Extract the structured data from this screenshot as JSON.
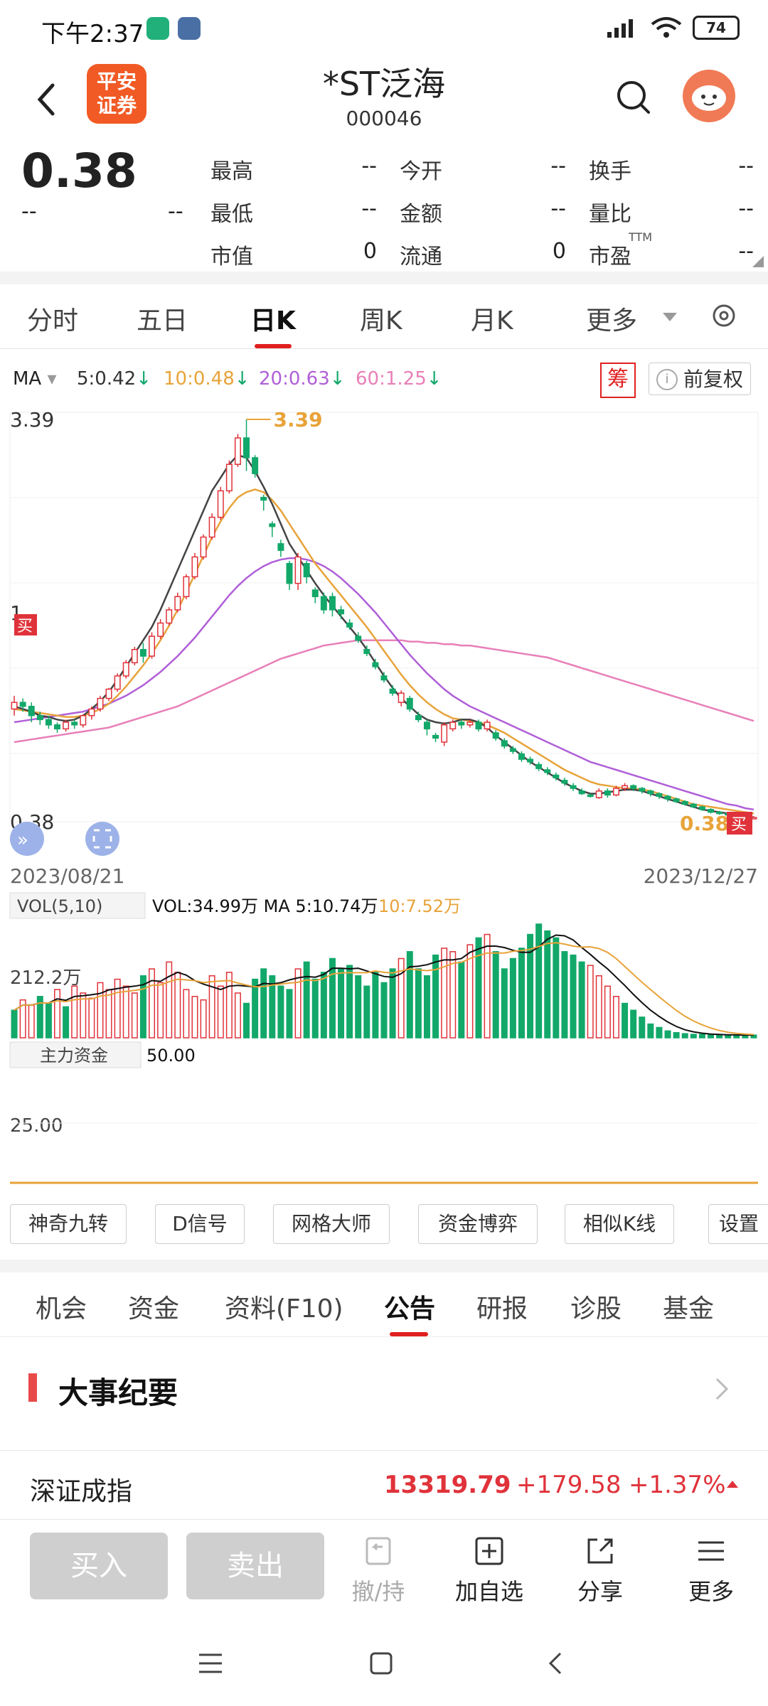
{
  "status_bar": {
    "time": "下午2:37",
    "battery": "74"
  },
  "header": {
    "logo_line1": "平安",
    "logo_line2": "证券",
    "title": "*ST泛海",
    "code": "000046"
  },
  "quote": {
    "price": "0.38",
    "change": "--",
    "change_pct": "--",
    "fields": [
      {
        "label": "最高",
        "value": "--"
      },
      {
        "label": "今开",
        "value": "--"
      },
      {
        "label": "换手",
        "value": "--"
      },
      {
        "label": "最低",
        "value": "--"
      },
      {
        "label": "金额",
        "value": "--"
      },
      {
        "label": "量比",
        "value": "--"
      },
      {
        "label": "市值",
        "value": "0"
      },
      {
        "label": "流通",
        "value": "0"
      },
      {
        "label": "市盈",
        "value": "--"
      }
    ],
    "pe_superscript": "TTM"
  },
  "kline_tabs": [
    "分时",
    "五日",
    "日K",
    "周K",
    "月K",
    "更多"
  ],
  "kline_active": "日K",
  "ma_bar": {
    "label": "MA",
    "items": [
      {
        "text": "5:0.42",
        "color": "#333333"
      },
      {
        "text": "10:0.48",
        "color": "#e8a33a"
      },
      {
        "text": "20:0.63",
        "color": "#b05fd8"
      },
      {
        "text": "60:1.25",
        "color": "#e87fb8"
      }
    ],
    "chip_label": "筹",
    "adjust_label": "前复权"
  },
  "chart_data": {
    "type": "candlestick",
    "price_high_label": "3.39",
    "price_low_label": "0.38",
    "price_mid_label": "1",
    "max_marker": "3.39",
    "last_marker": "0.38",
    "buy_marker": "买",
    "date_start": "2023/08/21",
    "date_end": "2023/12/27",
    "ylim": [
      0.38,
      3.39
    ],
    "candles": [
      [
        1.2,
        1.25,
        1.15,
        1.3
      ],
      [
        1.25,
        1.22,
        1.18,
        1.28
      ],
      [
        1.22,
        1.15,
        1.1,
        1.25
      ],
      [
        1.15,
        1.12,
        1.08,
        1.18
      ],
      [
        1.12,
        1.08,
        1.05,
        1.15
      ],
      [
        1.08,
        1.05,
        1.02,
        1.1
      ],
      [
        1.05,
        1.1,
        1.03,
        1.12
      ],
      [
        1.1,
        1.08,
        1.05,
        1.12
      ],
      [
        1.08,
        1.15,
        1.06,
        1.16
      ],
      [
        1.15,
        1.2,
        1.12,
        1.22
      ],
      [
        1.2,
        1.28,
        1.18,
        1.3
      ],
      [
        1.28,
        1.35,
        1.26,
        1.36
      ],
      [
        1.35,
        1.45,
        1.33,
        1.47
      ],
      [
        1.45,
        1.55,
        1.43,
        1.57
      ],
      [
        1.55,
        1.65,
        1.53,
        1.67
      ],
      [
        1.65,
        1.6,
        1.55,
        1.7
      ],
      [
        1.6,
        1.75,
        1.58,
        1.78
      ],
      [
        1.75,
        1.85,
        1.73,
        1.88
      ],
      [
        1.85,
        1.95,
        1.83,
        1.97
      ],
      [
        1.95,
        2.05,
        1.93,
        2.08
      ],
      [
        2.05,
        2.2,
        2.03,
        2.22
      ],
      [
        2.2,
        2.35,
        2.18,
        2.38
      ],
      [
        2.35,
        2.5,
        2.33,
        2.52
      ],
      [
        2.5,
        2.65,
        2.48,
        2.68
      ],
      [
        2.65,
        2.85,
        2.63,
        2.88
      ],
      [
        2.85,
        3.05,
        2.83,
        3.08
      ],
      [
        3.05,
        3.25,
        3.03,
        3.28
      ],
      [
        3.25,
        3.1,
        3.0,
        3.39
      ],
      [
        3.1,
        2.98,
        2.95,
        3.12
      ],
      [
        2.8,
        2.78,
        2.7,
        2.82
      ],
      [
        2.6,
        2.58,
        2.5,
        2.62
      ],
      [
        2.45,
        2.4,
        2.35,
        2.48
      ],
      [
        2.3,
        2.15,
        2.1,
        2.32
      ],
      [
        2.15,
        2.35,
        2.1,
        2.38
      ],
      [
        2.3,
        2.2,
        2.15,
        2.32
      ],
      [
        2.1,
        2.05,
        2.0,
        2.12
      ],
      [
        2.05,
        1.95,
        1.92,
        2.08
      ],
      [
        2.05,
        1.95,
        1.9,
        2.08
      ],
      [
        1.95,
        1.92,
        1.88,
        1.98
      ],
      [
        1.85,
        1.82,
        1.8,
        1.88
      ],
      [
        1.75,
        1.72,
        1.7,
        1.78
      ],
      [
        1.65,
        1.62,
        1.6,
        1.68
      ],
      [
        1.55,
        1.52,
        1.5,
        1.58
      ],
      [
        1.45,
        1.42,
        1.4,
        1.48
      ],
      [
        1.35,
        1.32,
        1.3,
        1.38
      ],
      [
        1.25,
        1.32,
        1.22,
        1.34
      ],
      [
        1.28,
        1.2,
        1.18,
        1.3
      ],
      [
        1.15,
        1.12,
        1.1,
        1.18
      ],
      [
        1.1,
        1.05,
        1.0,
        1.12
      ],
      [
        1.0,
        0.98,
        0.95,
        1.02
      ],
      [
        0.95,
        1.08,
        0.92,
        1.1
      ],
      [
        1.05,
        1.1,
        1.03,
        1.12
      ],
      [
        1.1,
        1.08,
        1.05,
        1.12
      ],
      [
        1.08,
        1.1,
        1.06,
        1.12
      ],
      [
        1.1,
        1.05,
        1.03,
        1.12
      ],
      [
        1.05,
        1.1,
        1.03,
        1.12
      ],
      [
        1.02,
        0.98,
        0.96,
        1.04
      ],
      [
        0.96,
        0.92,
        0.9,
        0.98
      ],
      [
        0.9,
        0.88,
        0.86,
        0.92
      ],
      [
        0.86,
        0.82,
        0.8,
        0.88
      ],
      [
        0.82,
        0.8,
        0.78,
        0.84
      ],
      [
        0.78,
        0.75,
        0.73,
        0.8
      ],
      [
        0.74,
        0.72,
        0.7,
        0.76
      ],
      [
        0.7,
        0.68,
        0.66,
        0.72
      ],
      [
        0.66,
        0.64,
        0.62,
        0.68
      ],
      [
        0.62,
        0.6,
        0.58,
        0.64
      ],
      [
        0.58,
        0.56,
        0.55,
        0.6
      ],
      [
        0.55,
        0.54,
        0.53,
        0.56
      ],
      [
        0.53,
        0.58,
        0.52,
        0.6
      ],
      [
        0.58,
        0.55,
        0.53,
        0.6
      ],
      [
        0.55,
        0.6,
        0.54,
        0.62
      ],
      [
        0.6,
        0.62,
        0.58,
        0.64
      ],
      [
        0.62,
        0.6,
        0.58,
        0.63
      ],
      [
        0.6,
        0.58,
        0.56,
        0.61
      ],
      [
        0.58,
        0.56,
        0.54,
        0.59
      ],
      [
        0.56,
        0.54,
        0.52,
        0.57
      ],
      [
        0.54,
        0.52,
        0.5,
        0.55
      ],
      [
        0.52,
        0.5,
        0.49,
        0.53
      ],
      [
        0.5,
        0.48,
        0.47,
        0.51
      ],
      [
        0.48,
        0.46,
        0.45,
        0.49
      ],
      [
        0.46,
        0.44,
        0.43,
        0.47
      ],
      [
        0.44,
        0.42,
        0.41,
        0.45
      ],
      [
        0.42,
        0.41,
        0.4,
        0.43
      ],
      [
        0.41,
        0.4,
        0.39,
        0.42
      ],
      [
        0.4,
        0.39,
        0.38,
        0.41
      ],
      [
        0.39,
        0.38,
        0.38,
        0.4
      ],
      [
        0.38,
        0.38,
        0.38,
        0.39
      ]
    ],
    "ma5": [
      1.22,
      1.2,
      1.18,
      1.15,
      1.14,
      1.12,
      1.11,
      1.12,
      1.15,
      1.2,
      1.26,
      1.33,
      1.42,
      1.52,
      1.62,
      1.72,
      1.82,
      1.95,
      2.1,
      2.25,
      2.4,
      2.55,
      2.7,
      2.85,
      2.95,
      3.05,
      3.12,
      3.1,
      3.0,
      2.88,
      2.75,
      2.6,
      2.45,
      2.35,
      2.25,
      2.15,
      2.06,
      1.98,
      1.9,
      1.82,
      1.74,
      1.65,
      1.55,
      1.45,
      1.36,
      1.28,
      1.22,
      1.16,
      1.12,
      1.1,
      1.09,
      1.1,
      1.12,
      1.12,
      1.1,
      1.06,
      1.0,
      0.95,
      0.9,
      0.85,
      0.8,
      0.76,
      0.72,
      0.68,
      0.64,
      0.61,
      0.58,
      0.56,
      0.56,
      0.57,
      0.58,
      0.59,
      0.59,
      0.58,
      0.56,
      0.54,
      0.52,
      0.5,
      0.48,
      0.46,
      0.44,
      0.43,
      0.42,
      0.41,
      0.4,
      0.39,
      0.38
    ],
    "ma10": [
      1.2,
      1.19,
      1.18,
      1.17,
      1.16,
      1.15,
      1.14,
      1.14,
      1.15,
      1.17,
      1.2,
      1.24,
      1.3,
      1.37,
      1.45,
      1.53,
      1.62,
      1.72,
      1.83,
      1.95,
      2.08,
      2.22,
      2.36,
      2.5,
      2.62,
      2.72,
      2.8,
      2.84,
      2.86,
      2.84,
      2.78,
      2.7,
      2.6,
      2.5,
      2.4,
      2.3,
      2.22,
      2.14,
      2.06,
      1.98,
      1.9,
      1.82,
      1.73,
      1.64,
      1.55,
      1.46,
      1.38,
      1.31,
      1.25,
      1.2,
      1.16,
      1.13,
      1.12,
      1.11,
      1.1,
      1.08,
      1.05,
      1.02,
      0.98,
      0.94,
      0.9,
      0.86,
      0.82,
      0.78,
      0.74,
      0.71,
      0.68,
      0.65,
      0.63,
      0.62,
      0.61,
      0.6,
      0.6,
      0.59,
      0.58,
      0.56,
      0.54,
      0.52,
      0.5,
      0.48,
      0.47,
      0.46,
      0.45,
      0.44,
      0.43,
      0.42,
      0.41
    ],
    "ma20": [
      1.1,
      1.11,
      1.12,
      1.13,
      1.14,
      1.15,
      1.16,
      1.17,
      1.18,
      1.2,
      1.22,
      1.24,
      1.27,
      1.3,
      1.34,
      1.38,
      1.43,
      1.48,
      1.54,
      1.6,
      1.67,
      1.74,
      1.82,
      1.9,
      1.98,
      2.06,
      2.13,
      2.19,
      2.24,
      2.28,
      2.31,
      2.33,
      2.34,
      2.34,
      2.33,
      2.31,
      2.28,
      2.24,
      2.19,
      2.13,
      2.07,
      2.0,
      1.93,
      1.85,
      1.77,
      1.69,
      1.61,
      1.54,
      1.47,
      1.41,
      1.35,
      1.3,
      1.26,
      1.22,
      1.19,
      1.16,
      1.13,
      1.1,
      1.07,
      1.04,
      1.01,
      0.98,
      0.95,
      0.92,
      0.89,
      0.86,
      0.83,
      0.8,
      0.78,
      0.76,
      0.74,
      0.72,
      0.7,
      0.68,
      0.66,
      0.64,
      0.62,
      0.6,
      0.58,
      0.56,
      0.54,
      0.52,
      0.5,
      0.48,
      0.47,
      0.45,
      0.44
    ],
    "ma60": [
      0.95,
      0.96,
      0.97,
      0.98,
      0.99,
      1.0,
      1.01,
      1.02,
      1.03,
      1.04,
      1.05,
      1.06,
      1.08,
      1.1,
      1.12,
      1.14,
      1.16,
      1.18,
      1.2,
      1.22,
      1.25,
      1.28,
      1.31,
      1.34,
      1.37,
      1.4,
      1.43,
      1.46,
      1.49,
      1.52,
      1.55,
      1.58,
      1.6,
      1.62,
      1.64,
      1.66,
      1.68,
      1.69,
      1.7,
      1.71,
      1.72,
      1.72,
      1.72,
      1.72,
      1.72,
      1.72,
      1.71,
      1.71,
      1.7,
      1.7,
      1.69,
      1.69,
      1.68,
      1.68,
      1.67,
      1.66,
      1.65,
      1.64,
      1.63,
      1.62,
      1.61,
      1.6,
      1.59,
      1.57,
      1.55,
      1.53,
      1.51,
      1.49,
      1.47,
      1.45,
      1.43,
      1.41,
      1.39,
      1.37,
      1.35,
      1.33,
      1.31,
      1.29,
      1.27,
      1.25,
      1.23,
      1.21,
      1.19,
      1.17,
      1.15,
      1.13,
      1.11
    ],
    "volume_label": "VOL(5,10)",
    "volume_values": "VOL:34.99万 MA 5:10.74万",
    "volume_ma10": "10:7.52万",
    "volume_level": "212.2万",
    "volumes": [
      80,
      110,
      95,
      120,
      100,
      140,
      90,
      150,
      130,
      115,
      160,
      140,
      170,
      150,
      130,
      180,
      200,
      160,
      220,
      190,
      140,
      120,
      110,
      180,
      150,
      190,
      130,
      100,
      170,
      200,
      180,
      150,
      140,
      200,
      220,
      170,
      190,
      230,
      200,
      210,
      180,
      150,
      190,
      160,
      200,
      230,
      250,
      200,
      180,
      240,
      260,
      250,
      220,
      270,
      290,
      300,
      250,
      200,
      230,
      260,
      300,
      330,
      310,
      290,
      250,
      240,
      220,
      210,
      180,
      150,
      120,
      100,
      80,
      60,
      40,
      30,
      20,
      15,
      12,
      10,
      10,
      8,
      8,
      8,
      8,
      8,
      8
    ],
    "volumes_up": [
      false,
      true,
      true,
      false,
      false,
      true,
      false,
      true,
      true,
      true,
      true,
      true,
      true,
      true,
      true,
      false,
      true,
      true,
      true,
      true,
      true,
      true,
      true,
      true,
      true,
      true,
      true,
      false,
      false,
      false,
      false,
      false,
      false,
      true,
      false,
      false,
      false,
      false,
      false,
      false,
      false,
      false,
      false,
      false,
      false,
      true,
      false,
      false,
      false,
      false,
      true,
      true,
      false,
      true,
      false,
      true,
      false,
      false,
      false,
      false,
      false,
      false,
      false,
      false,
      false,
      false,
      false,
      true,
      true,
      true,
      true,
      false,
      false,
      false,
      false,
      false,
      false,
      false,
      false,
      false,
      false,
      false,
      false,
      false,
      false,
      false,
      false
    ],
    "fund_label": "主力资金",
    "fund_value": "50.00",
    "fund_level": "25.00"
  },
  "tools": [
    "神奇九转",
    "D信号",
    "网格大师",
    "资金博弈",
    "相似K线",
    "设置"
  ],
  "info_tabs": [
    "机会",
    "资金",
    "资料(F10)",
    "公告",
    "研报",
    "诊股",
    "基金"
  ],
  "info_active": "公告",
  "section_title": "大事纪要",
  "index": {
    "name": "深证成指",
    "value": "13319.79",
    "change": "+179.58",
    "change_pct": "+1.37%"
  },
  "bottom": {
    "buy": "买入",
    "sell": "卖出",
    "items": [
      "撤/持",
      "加自选",
      "分享",
      "更多"
    ]
  },
  "colors": {
    "up": "#e0323a",
    "down": "#12a86a",
    "accent": "#e02020"
  }
}
